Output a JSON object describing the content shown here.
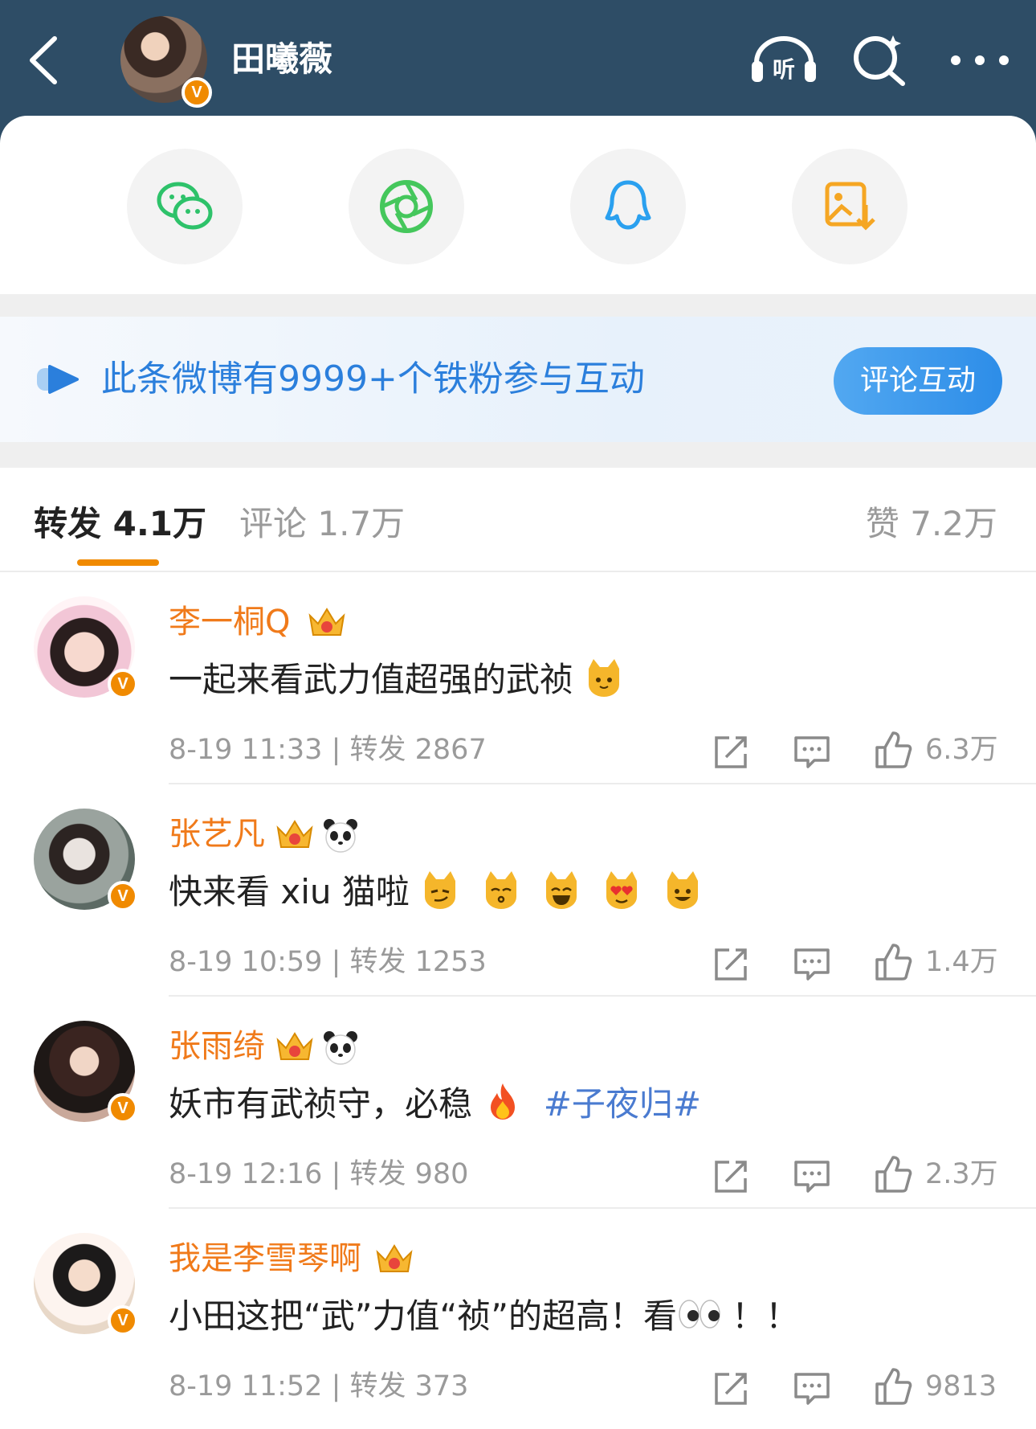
{
  "header": {
    "title": "田曦薇",
    "verified_mark": "V",
    "listen_label": "听",
    "icons": [
      "back-arrow-icon",
      "listen-headphone-icon",
      "search-icon",
      "more-icon"
    ]
  },
  "share_targets": [
    "wechat-icon",
    "moments-icon",
    "qq-icon",
    "save-image-icon"
  ],
  "fan_bar": {
    "text": "此条微博有9999+个铁粉参与互动",
    "button": "评论互动"
  },
  "tabs": {
    "repost": "转发 4.1万",
    "comment": "评论 1.7万",
    "like": "赞 7.2万"
  },
  "reposts": [
    {
      "name": "李一桐Q",
      "text": "一起来看武力值超强的武祯",
      "emojis_after": [
        "cat-face-emoji"
      ],
      "time": "8-19 11:33",
      "repost_label": "转发",
      "repost_count": "2867",
      "likes": "6.3万",
      "badges": [
        "crown-badge"
      ]
    },
    {
      "name": "张艺凡",
      "text": "快来看 xiu 猫啦",
      "emojis_after": [
        "smirk-cat-emoji",
        "kissing-cat-emoji",
        "grinning-cat-emoji",
        "heart-eyes-cat-emoji",
        "smiling-cat-emoji"
      ],
      "time": "8-19 10:59",
      "repost_label": "转发",
      "repost_count": "1253",
      "likes": "1.4万",
      "badges": [
        "crown-badge",
        "panda-badge"
      ]
    },
    {
      "name": "张雨绮",
      "text": "妖市有武祯守，必稳",
      "emojis_after": [
        "fire-emoji"
      ],
      "hashtag": "#子夜归#",
      "time": "8-19 12:16",
      "repost_label": "转发",
      "repost_count": "980",
      "likes": "2.3万",
      "badges": [
        "crown-badge",
        "panda-badge"
      ]
    },
    {
      "name": "我是李雪琴啊",
      "text_before": "小田这把“武”力值“祯”的超高！看",
      "emojis_after": [
        "eyes-emoji"
      ],
      "text_after": "！！",
      "time": "8-19 11:52",
      "repost_label": "转发",
      "repost_count": "373",
      "likes": "9813",
      "badges": [
        "crown-badge"
      ]
    }
  ],
  "colors": {
    "header_bg": "#2e4d66",
    "username": "#f07a1a",
    "accent_orange": "#f08a00",
    "link_blue": "#2b7fdc",
    "hashtag": "#4a7bd0",
    "meta_gray": "#9a9a9a"
  }
}
